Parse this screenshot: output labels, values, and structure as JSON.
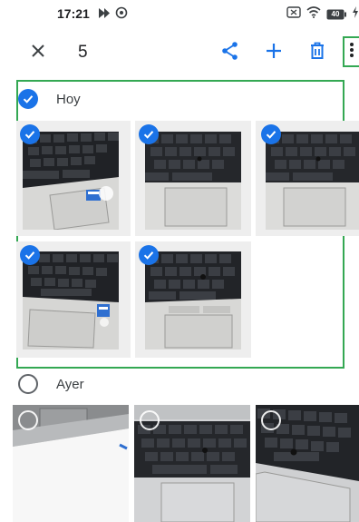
{
  "status_bar": {
    "time": "17:21",
    "left_icons": [
      "media-play-icon",
      "alarm-icon"
    ],
    "right_icons": [
      "screenshot-icon",
      "wifi-icon",
      "battery-icon",
      "charging-icon"
    ],
    "battery_level": "40"
  },
  "toolbar": {
    "close_icon": "close-icon",
    "selected_count": "5",
    "share_icon": "share-icon",
    "add_icon": "add-icon",
    "delete_icon": "trash-icon",
    "more_icon": "more-vertical-icon"
  },
  "sections": [
    {
      "label": "Hoy",
      "selected": true,
      "photos": [
        {
          "subject": "keyboard-with-sticker",
          "selected": true
        },
        {
          "subject": "keyboard-closeup",
          "selected": true
        },
        {
          "subject": "keyboard-closeup",
          "selected": true
        },
        {
          "subject": "keyboard-with-sticker",
          "selected": true
        },
        {
          "subject": "keyboard-trackpoint",
          "selected": true
        }
      ]
    },
    {
      "label": "Ayer",
      "selected": false,
      "photos": [
        {
          "subject": "laptop-on-desk",
          "selected": false
        },
        {
          "subject": "keyboard-angle",
          "selected": false
        },
        {
          "subject": "keyboard-angle",
          "selected": false
        }
      ]
    }
  ],
  "colors": {
    "accent": "#1a73e8",
    "highlight_border": "#34a853"
  }
}
